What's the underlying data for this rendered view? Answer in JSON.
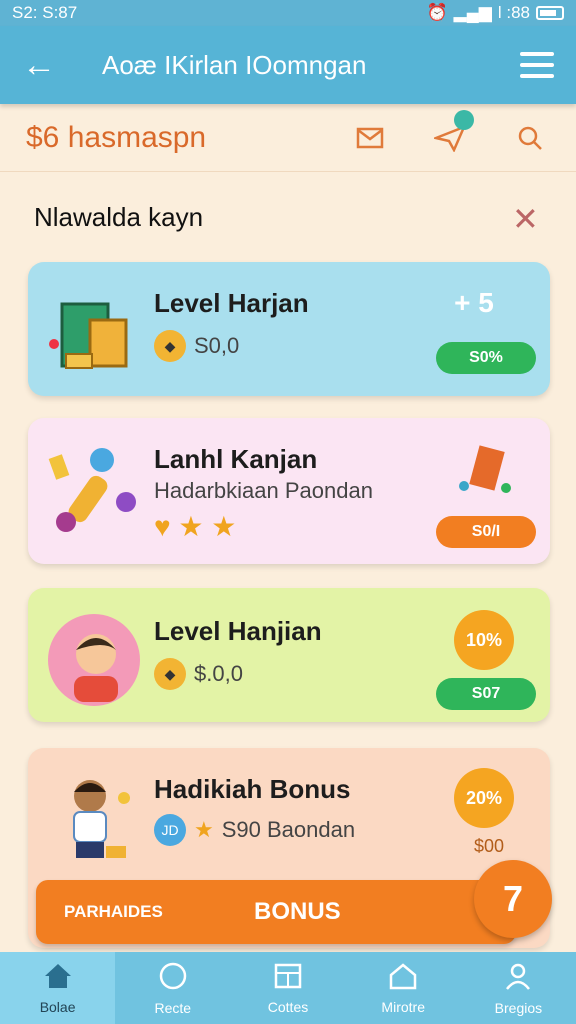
{
  "status": {
    "time": "S2: S:87",
    "right": "l :88"
  },
  "header": {
    "title": "Aoæ IKirlan IOomngan"
  },
  "balance": {
    "text": "$6 hasmaspn"
  },
  "section": {
    "title": "Nlawalda kayn"
  },
  "cards": [
    {
      "name": "Level Harjan",
      "value": "S0,0",
      "badge": "+ 5",
      "pill": "S0%"
    },
    {
      "name": "Lanhl Kanjan",
      "desc": "Hadarbkiaan Paondan",
      "pill": "S0/I"
    },
    {
      "name": "Level Hanjian",
      "value": "$.0,0",
      "badge": "10%",
      "pill": "S07"
    },
    {
      "name": "Hadikiah Bonus",
      "coin": "JD",
      "value": "S90 Baondan",
      "badge": "20%",
      "badge_sub": "$00"
    }
  ],
  "bonus_bar": {
    "left": "PARHAIDES",
    "center": "BONUS"
  },
  "fab": {
    "label": "7"
  },
  "nav": [
    {
      "label": "Bolae",
      "active": true
    },
    {
      "label": "Recte"
    },
    {
      "label": "Cottes"
    },
    {
      "label": "Mirotre"
    },
    {
      "label": "Bregios"
    }
  ],
  "colors": {
    "accent": "#f27e21",
    "header": "#56b4d6",
    "green": "#2fb55a"
  }
}
